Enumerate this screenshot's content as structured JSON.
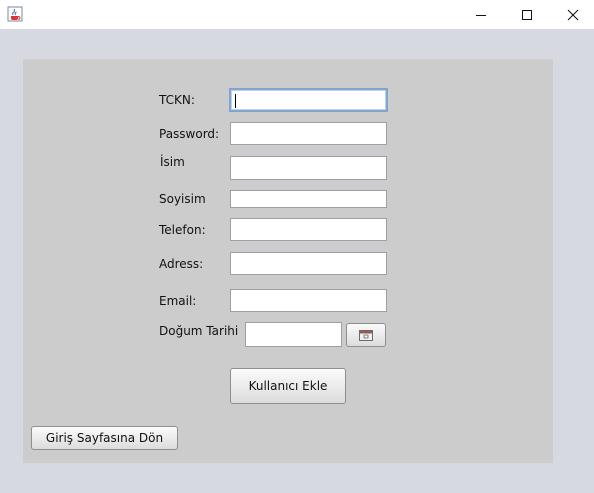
{
  "window": {
    "icons": {
      "app": "java-coffee-cup-icon",
      "minimize": "minimize-icon",
      "maximize": "maximize-icon",
      "close": "close-icon"
    }
  },
  "form": {
    "fields": {
      "tckn": {
        "label": "TCKN:",
        "value": ""
      },
      "password": {
        "label": "Password:",
        "value": ""
      },
      "isim": {
        "label": "İsim",
        "value": ""
      },
      "soyisim": {
        "label": "Soyisim",
        "value": ""
      },
      "telefon": {
        "label": "Telefon:",
        "value": ""
      },
      "adress": {
        "label": "Adress:",
        "value": ""
      },
      "email": {
        "label": "Email:",
        "value": ""
      },
      "dogum_tarihi": {
        "label": "Doğum Tarihi",
        "value": "",
        "picker_icon": "calendar-icon"
      }
    },
    "submit_label": "Kullanıcı Ekle",
    "back_label": "Giriş Sayfasına Dön"
  },
  "colors": {
    "window_bg": "#d7d9e0",
    "panel_bg": "#cccccc",
    "focus_border": "#7ea6cf"
  }
}
